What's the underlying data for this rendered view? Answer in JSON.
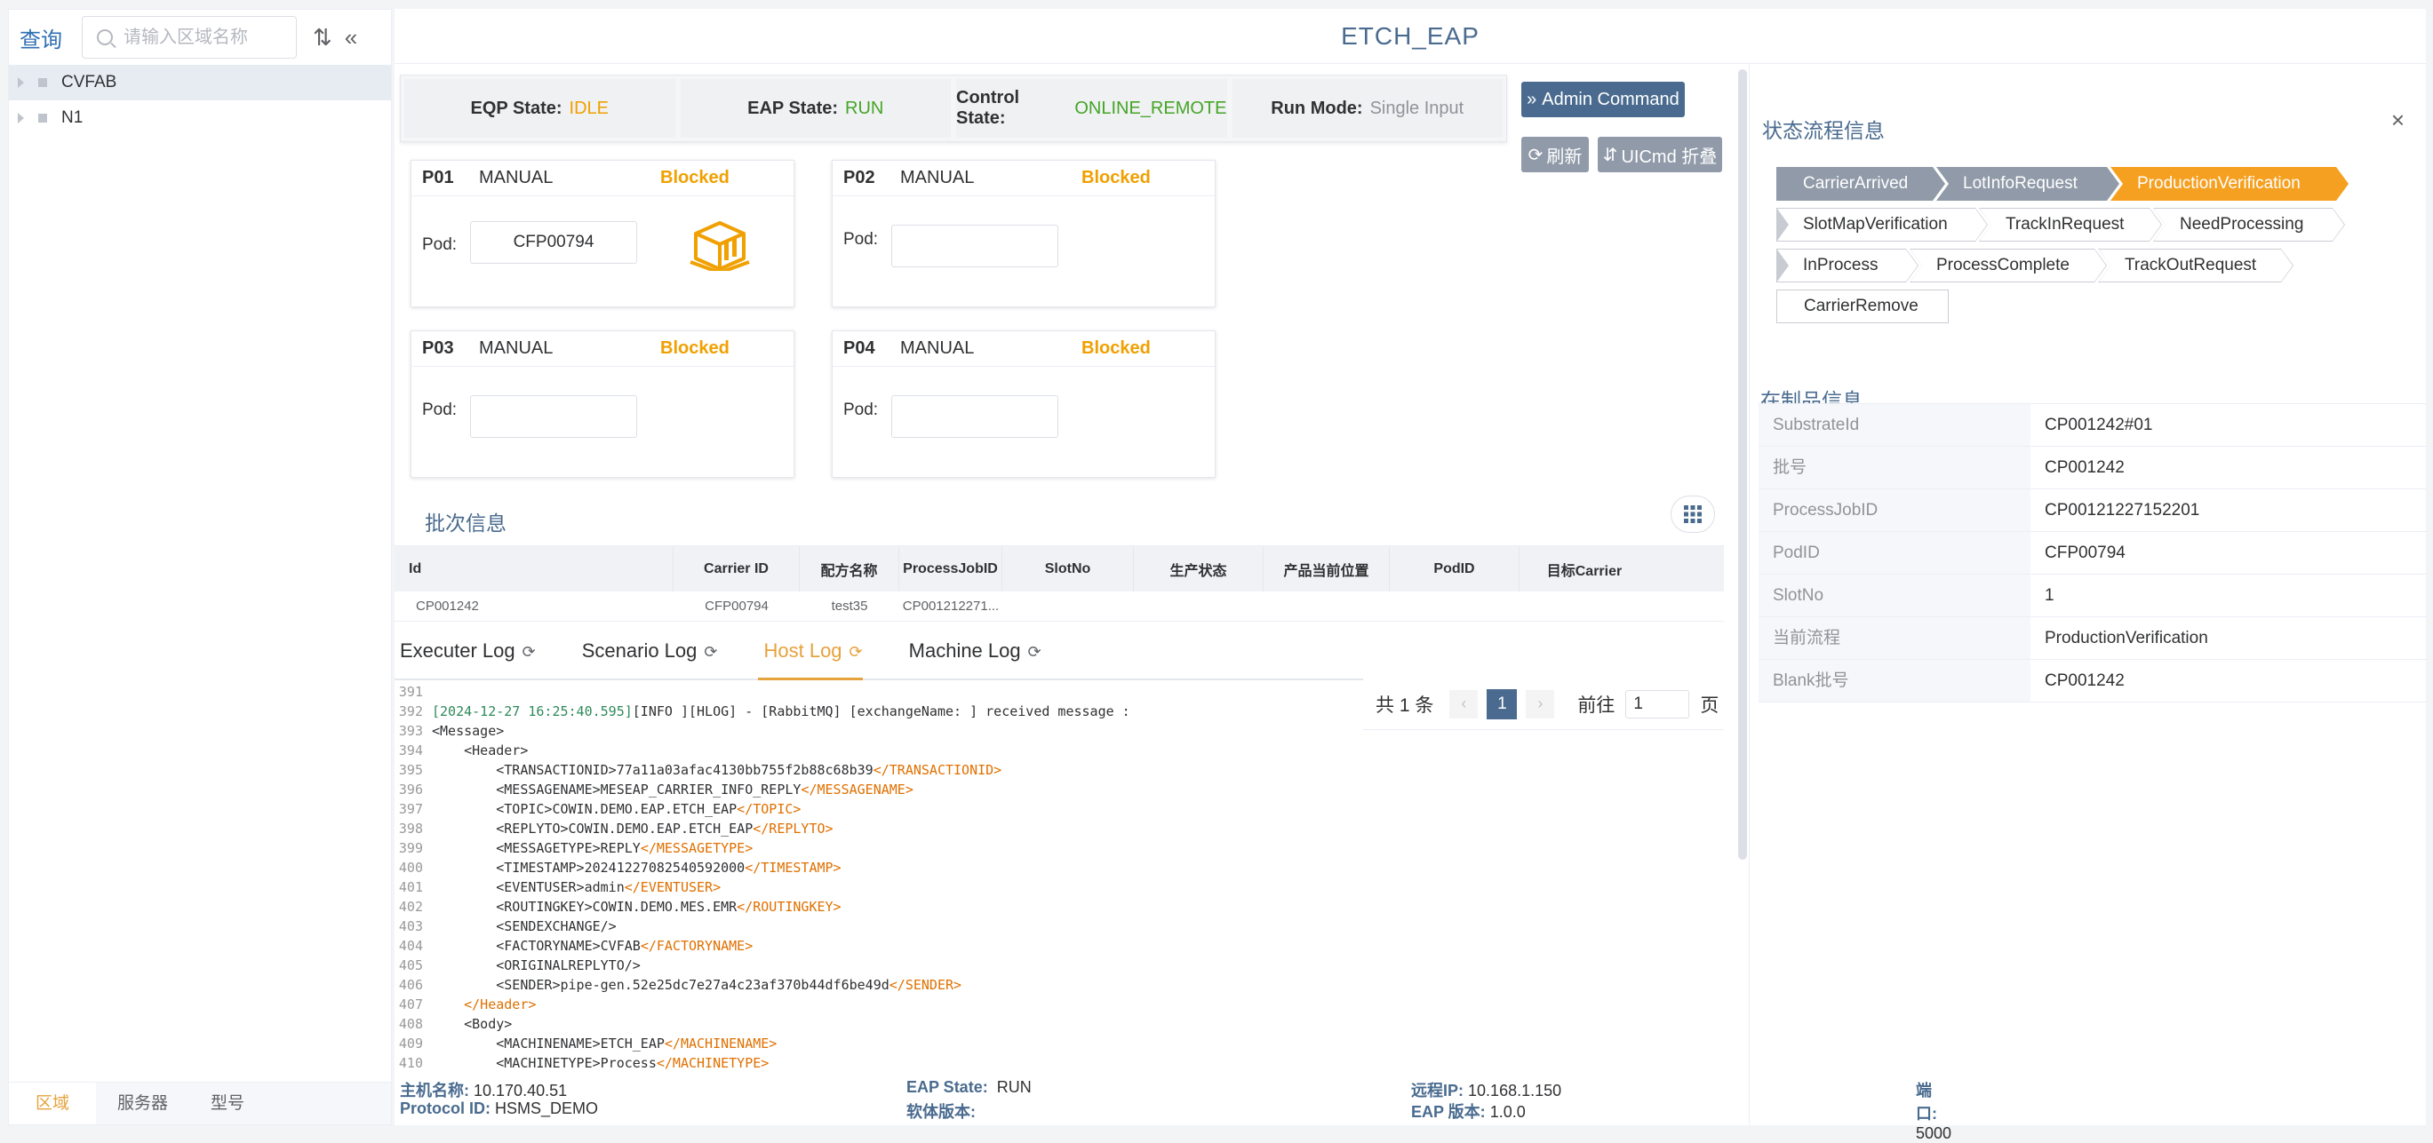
{
  "sidebar": {
    "title": "查询",
    "search_placeholder": "请输入区域名称",
    "tree": [
      {
        "label": "CVFAB",
        "selected": true
      },
      {
        "label": "N1",
        "selected": false
      }
    ],
    "tabs": [
      "区域",
      "服务器",
      "型号"
    ]
  },
  "app_title": "ETCH_EAP",
  "states": [
    {
      "label": "EQP State:",
      "value": "IDLE",
      "color": "#f0a000"
    },
    {
      "label": "EAP State:",
      "value": "RUN",
      "color": "#44a526"
    },
    {
      "label": "Control State:",
      "value": "ONLINE_REMOTE",
      "color": "#44a526"
    },
    {
      "label": "Run Mode:",
      "value": "Single Input",
      "color": "#909399"
    }
  ],
  "buttons": {
    "admin_command": "Admin Command",
    "refresh": "刷新",
    "uicmd_fold": "UICmd 折叠"
  },
  "ports": [
    {
      "id": "P01",
      "mode": "MANUAL",
      "status": "Blocked",
      "pod_label": "Pod:",
      "pod": "CFP00794",
      "has_carrier_icon": true
    },
    {
      "id": "P02",
      "mode": "MANUAL",
      "status": "Blocked",
      "pod_label": "Pod:",
      "pod": "",
      "has_carrier_icon": false
    },
    {
      "id": "P03",
      "mode": "MANUAL",
      "status": "Blocked",
      "pod_label": "Pod:",
      "pod": "",
      "has_carrier_icon": false
    },
    {
      "id": "P04",
      "mode": "MANUAL",
      "status": "Blocked",
      "pod_label": "Pod:",
      "pod": "",
      "has_carrier_icon": false
    }
  ],
  "lot_section": {
    "title": "批次信息",
    "columns": [
      "Id",
      "Carrier ID",
      "配方名称",
      "ProcessJobID",
      "SlotNo",
      "生产状态",
      "产品当前位置",
      "PodID",
      "目标Carrier"
    ],
    "rows": [
      [
        "CP001242",
        "CFP00794",
        "test35",
        "CP001212271...",
        "",
        "",
        "",
        "",
        ""
      ]
    ]
  },
  "log_tabs": [
    {
      "label": "Executer Log",
      "active": false
    },
    {
      "label": "Scenario Log",
      "active": false
    },
    {
      "label": "Host Log",
      "active": true
    },
    {
      "label": "Machine Log",
      "active": false
    }
  ],
  "pager": {
    "total": "共 1 条",
    "current": "1",
    "goto_label": "前往",
    "goto_value": "1",
    "page_suffix": "页"
  },
  "log_lines": [
    {
      "no": "391",
      "text": ""
    },
    {
      "no": "392",
      "text": "[2024-12-27 16:25:40.595][INFO ][HLOG] - [RabbitMQ] [exchangeName: ] received message :"
    },
    {
      "no": "393",
      "text": "<Message>"
    },
    {
      "no": "394",
      "text": "    <Header>"
    },
    {
      "no": "395",
      "text": "        <TRANSACTIONID>77a11a03afac4130bb755f2b88c68b39</TRANSACTIONID>"
    },
    {
      "no": "396",
      "text": "        <MESSAGENAME>MESEAP_CARRIER_INFO_REPLY</MESSAGENAME>"
    },
    {
      "no": "397",
      "text": "        <TOPIC>COWIN.DEMO.EAP.ETCH_EAP</TOPIC>"
    },
    {
      "no": "398",
      "text": "        <REPLYTO>COWIN.DEMO.EAP.ETCH_EAP</REPLYTO>"
    },
    {
      "no": "399",
      "text": "        <MESSAGETYPE>REPLY</MESSAGETYPE>"
    },
    {
      "no": "400",
      "text": "        <TIMESTAMP>20241227082540592000</TIMESTAMP>"
    },
    {
      "no": "401",
      "text": "        <EVENTUSER>admin</EVENTUSER>"
    },
    {
      "no": "402",
      "text": "        <ROUTINGKEY>COWIN.DEMO.MES.EMR</ROUTINGKEY>"
    },
    {
      "no": "403",
      "text": "        <SENDEXCHANGE/>"
    },
    {
      "no": "404",
      "text": "        <FACTORYNAME>CVFAB</FACTORYNAME>"
    },
    {
      "no": "405",
      "text": "        <ORIGINALREPLYTO/>"
    },
    {
      "no": "406",
      "text": "        <SENDER>pipe-gen.52e25dc7e27a4c23af370b44df6be49d</SENDER>"
    },
    {
      "no": "407",
      "text": "    </Header>"
    },
    {
      "no": "408",
      "text": "    <Body>"
    },
    {
      "no": "409",
      "text": "        <MACHINENAME>ETCH_EAP</MACHINENAME>"
    },
    {
      "no": "410",
      "text": "        <MACHINETYPE>Process</MACHINETYPE>"
    }
  ],
  "footer": {
    "host_label": "主机名称:",
    "host": "10.170.40.51",
    "eap_state_label": "EAP State:",
    "eap_state": "RUN",
    "remote_ip_label": "远程IP:",
    "remote_ip": "10.168.1.150",
    "port_label": "端口:",
    "port": "5000",
    "protocol_label": "Protocol ID:",
    "protocol": "HSMS_DEMO",
    "sw_version_label": "软体版本:",
    "sw_version": "",
    "eap_version_label": "EAP 版本:",
    "eap_version": "1.0.0"
  },
  "right_panel": {
    "flow_title": "状态流程信息",
    "flow_steps": [
      {
        "label": "CarrierArrived",
        "state": "done"
      },
      {
        "label": "LotInfoRequest",
        "state": "done"
      },
      {
        "label": "ProductionVerification",
        "state": "current"
      },
      {
        "label": "SlotMapVerification",
        "state": "todo"
      },
      {
        "label": "TrackInRequest",
        "state": "todo"
      },
      {
        "label": "NeedProcessing",
        "state": "todo"
      },
      {
        "label": "InProcess",
        "state": "todo"
      },
      {
        "label": "ProcessComplete",
        "state": "todo"
      },
      {
        "label": "TrackOutRequest",
        "state": "todo"
      },
      {
        "label": "CarrierRemove",
        "state": "todo"
      }
    ],
    "wip_title": "在制品信息",
    "wip": [
      {
        "k": "SubstrateId",
        "v": "CP001242#01"
      },
      {
        "k": "批号",
        "v": "CP001242"
      },
      {
        "k": "ProcessJobID",
        "v": "CP00121227152201"
      },
      {
        "k": "PodID",
        "v": "CFP00794"
      },
      {
        "k": "SlotNo",
        "v": "1"
      },
      {
        "k": "当前流程",
        "v": "ProductionVerification"
      },
      {
        "k": "Blank批号",
        "v": "CP001242"
      }
    ]
  }
}
